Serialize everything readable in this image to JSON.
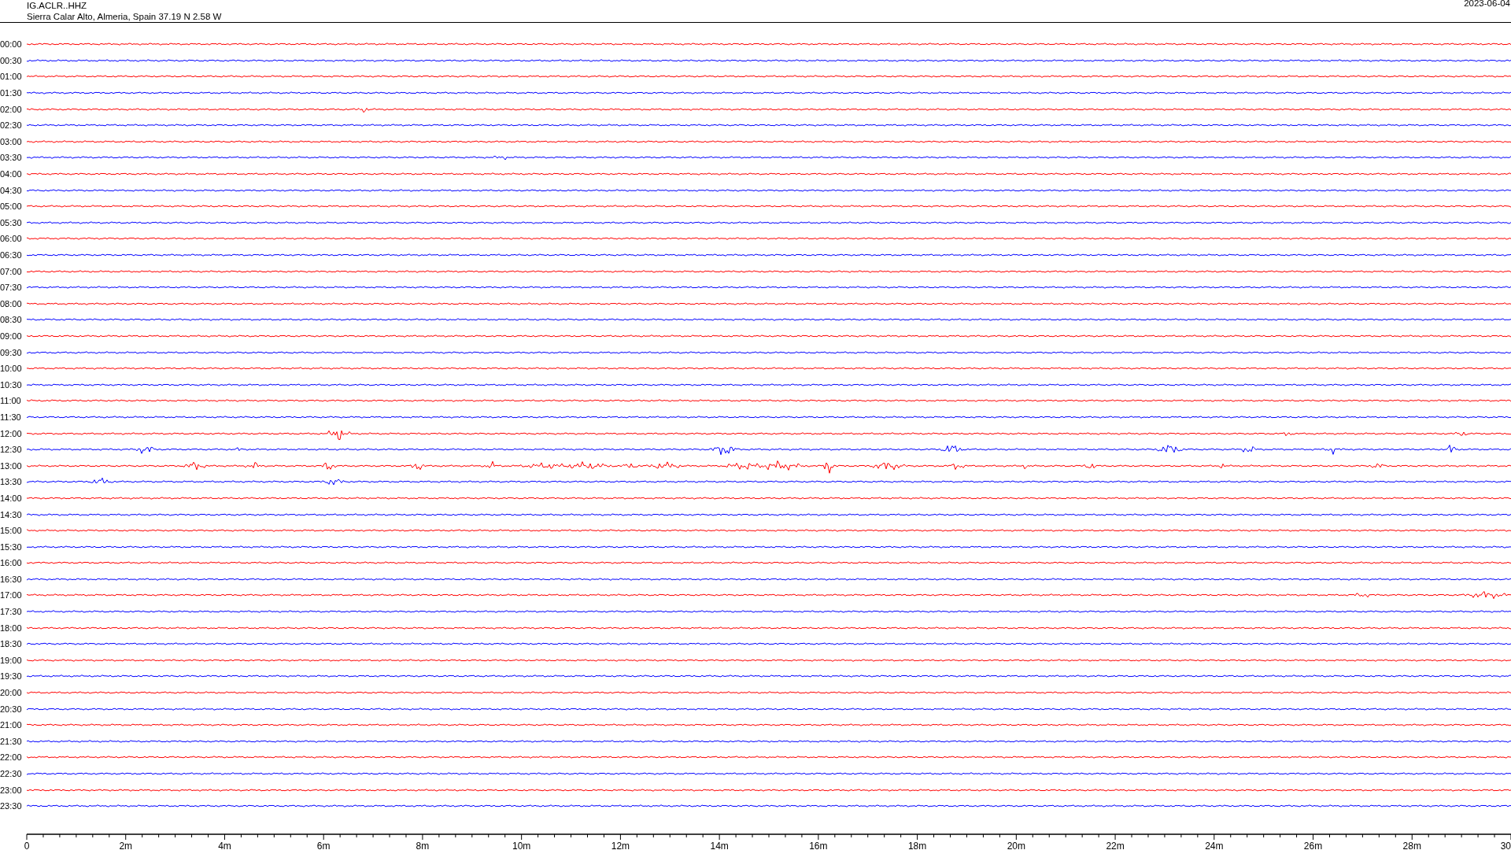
{
  "header": {
    "station": "IG.ACLR..HHZ",
    "location": "Sierra Calar Alto, Almeria, Spain  37.19 N 2.58 W",
    "date": "2023-06-04"
  },
  "rows": [
    {
      "time": "00:00",
      "color": "#ff0000"
    },
    {
      "time": "00:30",
      "color": "#0000ff"
    },
    {
      "time": "01:00",
      "color": "#ff0000"
    },
    {
      "time": "01:30",
      "color": "#0000ff"
    },
    {
      "time": "02:00",
      "color": "#ff0000"
    },
    {
      "time": "02:30",
      "color": "#0000ff"
    },
    {
      "time": "03:00",
      "color": "#ff0000"
    },
    {
      "time": "03:30",
      "color": "#0000ff"
    },
    {
      "time": "04:00",
      "color": "#ff0000"
    },
    {
      "time": "04:30",
      "color": "#0000ff"
    },
    {
      "time": "05:00",
      "color": "#ff0000"
    },
    {
      "time": "05:30",
      "color": "#0000ff"
    },
    {
      "time": "06:00",
      "color": "#ff0000"
    },
    {
      "time": "06:30",
      "color": "#0000ff"
    },
    {
      "time": "07:00",
      "color": "#ff0000"
    },
    {
      "time": "07:30",
      "color": "#0000ff"
    },
    {
      "time": "08:00",
      "color": "#ff0000"
    },
    {
      "time": "08:30",
      "color": "#0000ff"
    },
    {
      "time": "09:00",
      "color": "#ff0000"
    },
    {
      "time": "09:30",
      "color": "#0000ff"
    },
    {
      "time": "10:00",
      "color": "#ff0000"
    },
    {
      "time": "10:30",
      "color": "#0000ff"
    },
    {
      "time": "11:00",
      "color": "#ff0000"
    },
    {
      "time": "11:30",
      "color": "#0000ff"
    },
    {
      "time": "12:00",
      "color": "#ff0000"
    },
    {
      "time": "12:30",
      "color": "#0000ff"
    },
    {
      "time": "13:00",
      "color": "#ff0000"
    },
    {
      "time": "13:30",
      "color": "#0000ff"
    },
    {
      "time": "14:00",
      "color": "#ff0000"
    },
    {
      "time": "14:30",
      "color": "#0000ff"
    },
    {
      "time": "15:00",
      "color": "#ff0000"
    },
    {
      "time": "15:30",
      "color": "#0000ff"
    },
    {
      "time": "16:00",
      "color": "#ff0000"
    },
    {
      "time": "16:30",
      "color": "#0000ff"
    },
    {
      "time": "17:00",
      "color": "#ff0000"
    },
    {
      "time": "17:30",
      "color": "#0000ff"
    },
    {
      "time": "18:00",
      "color": "#ff0000"
    },
    {
      "time": "18:30",
      "color": "#0000ff"
    },
    {
      "time": "19:00",
      "color": "#ff0000"
    },
    {
      "time": "19:30",
      "color": "#0000ff"
    },
    {
      "time": "20:00",
      "color": "#ff0000"
    },
    {
      "time": "20:30",
      "color": "#0000ff"
    },
    {
      "time": "21:00",
      "color": "#ff0000"
    },
    {
      "time": "21:30",
      "color": "#0000ff"
    },
    {
      "time": "22:00",
      "color": "#ff0000"
    },
    {
      "time": "22:30",
      "color": "#0000ff"
    },
    {
      "time": "23:00",
      "color": "#ff0000"
    },
    {
      "time": "23:30",
      "color": "#0000ff"
    }
  ],
  "axis_labels": [
    "0",
    "2m",
    "4m",
    "6m",
    "8m",
    "10m",
    "12m",
    "14m",
    "16m",
    "18m",
    "20m",
    "22m",
    "24m",
    "26m",
    "28m",
    "30"
  ]
}
